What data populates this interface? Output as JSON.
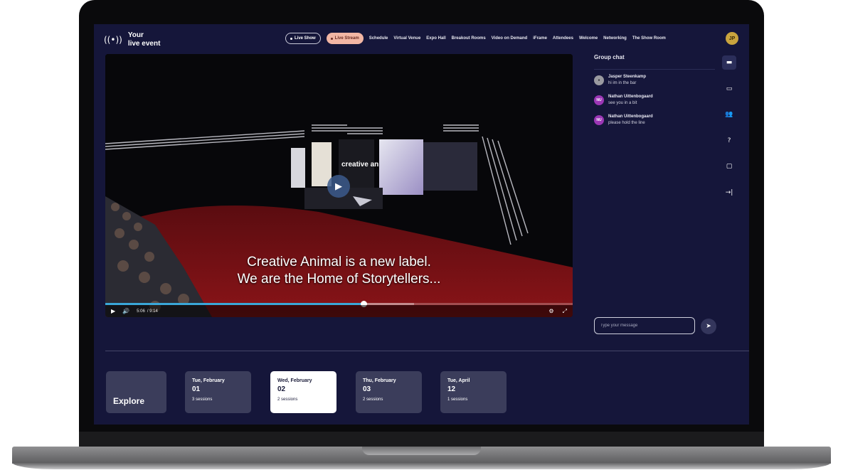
{
  "brand": {
    "icon": "broadcast-icon",
    "line1": "Your",
    "line2": "live event"
  },
  "nav": {
    "pills": [
      {
        "label": "Live Show",
        "style": "outline"
      },
      {
        "label": "Live Stream",
        "style": "filled",
        "color": "#f2b6a4"
      }
    ],
    "links": [
      "Schedule",
      "Virtual Venue",
      "Expo Hall",
      "Breakout Rooms",
      "Video on Demand",
      "iFrame",
      "Attendees",
      "Welcome",
      "Networking",
      "The Show Room"
    ],
    "user_initials": "JP"
  },
  "video": {
    "stage_text": "creative animal.",
    "subtitle_line1": "Creative Animal is a new label.",
    "subtitle_line2": "We are the Home of Storytellers...",
    "current_time": "5:06",
    "duration": "/ 9:14",
    "progress_fraction": 0.553,
    "buffered_fraction": 0.66,
    "accent_color": "#3aa7d8"
  },
  "chat": {
    "title": "Group chat",
    "messages": [
      {
        "initials": "",
        "avatar": "photo",
        "name": "Jasper Steenkamp",
        "text": "hi im in the bar"
      },
      {
        "initials": "NU",
        "avatar": "initials",
        "name": "Nathan Uittenbogaard",
        "text": "see you in a bit"
      },
      {
        "initials": "NU",
        "avatar": "initials",
        "name": "Nathan Uittenbogaard",
        "text": "please hold the line"
      }
    ],
    "input_placeholder": "Type your message",
    "rail_icons": [
      "chat-icon",
      "messages-icon",
      "people-icon",
      "help-icon",
      "calendar-icon",
      "collapse-icon"
    ]
  },
  "schedule": {
    "explore_label": "Explore",
    "days": [
      {
        "label": "Tue, February",
        "day": "01",
        "sessions": "3 sessions",
        "selected": false
      },
      {
        "label": "Wed, February",
        "day": "02",
        "sessions": "2 sessions",
        "selected": true
      },
      {
        "label": "Thu, February",
        "day": "03",
        "sessions": "2 sessions",
        "selected": false
      },
      {
        "label": "Tue, April",
        "day": "12",
        "sessions": "1 sessions",
        "selected": false
      }
    ]
  }
}
